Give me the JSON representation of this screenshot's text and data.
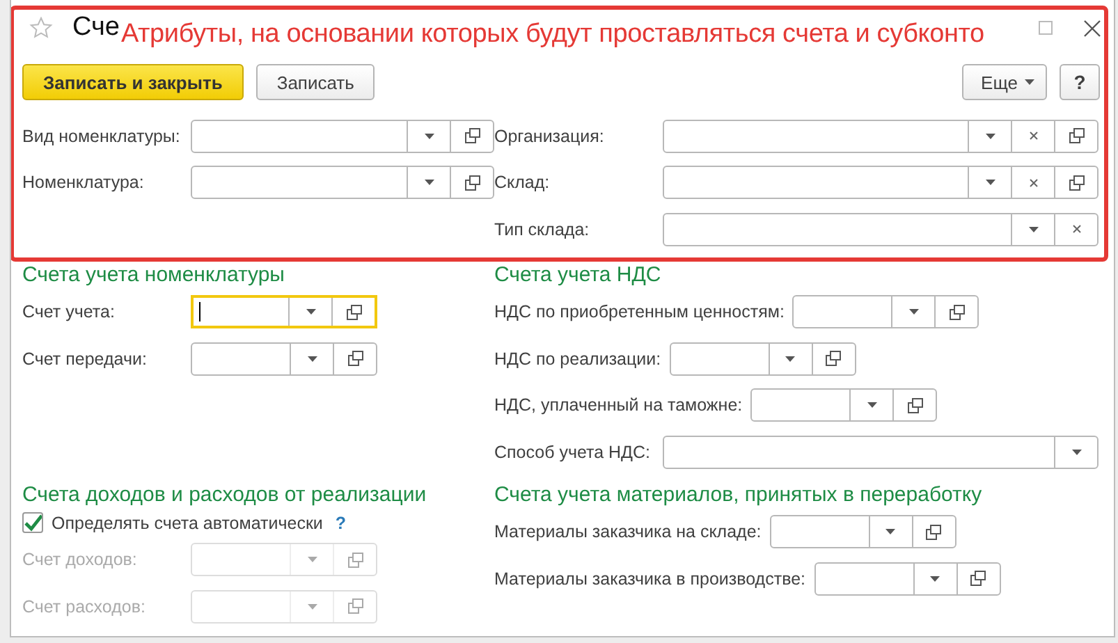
{
  "window": {
    "title": "Сче"
  },
  "annotation": {
    "text": "Атрибуты, на основании которых будут проставляться счета и субконто"
  },
  "toolbar": {
    "buttons": [
      {
        "label": "Записать и закрыть",
        "kind": "primary"
      },
      {
        "label": "Записать",
        "kind": "plain"
      }
    ],
    "more": "Еще",
    "help": "?"
  },
  "top": {
    "left": [
      {
        "label": "Вид номенклатуры:",
        "clear": false,
        "open": true,
        "disabled": false,
        "focused": false
      },
      {
        "label": "Номенклатура:",
        "clear": false,
        "open": true,
        "disabled": false,
        "focused": false
      }
    ],
    "right": [
      {
        "label": "Организация:",
        "clear": true,
        "open": true,
        "disabled": false,
        "focused": false
      },
      {
        "label": "Склад:",
        "clear": true,
        "open": true,
        "disabled": false,
        "focused": false
      },
      {
        "label": "Тип склада:",
        "clear": true,
        "open": false,
        "disabled": false,
        "focused": false
      }
    ]
  },
  "groups": [
    {
      "left": {
        "heading": "Счета учета номенклатуры",
        "fields": [
          {
            "label": "Счет учета:",
            "clear": false,
            "open": true,
            "disabled": false,
            "focused": true
          },
          {
            "label": "Счет передачи:",
            "clear": false,
            "open": true,
            "disabled": false,
            "focused": false
          }
        ]
      },
      "right": {
        "heading": "Счета учета НДС",
        "fields": [
          {
            "label": "НДС по приобретенным ценностям:",
            "clear": false,
            "open": true,
            "disabled": false,
            "focused": false
          },
          {
            "label": "НДС по реализации:",
            "clear": false,
            "open": true,
            "disabled": false,
            "focused": false
          },
          {
            "label": "НДС, уплаченный на таможне:",
            "clear": false,
            "open": true,
            "disabled": false,
            "focused": false
          },
          {
            "label": "Способ учета НДС:",
            "clear": false,
            "open": false,
            "disabled": false,
            "focused": false
          }
        ]
      }
    },
    {
      "left": {
        "heading": "Счета доходов и расходов от реализации",
        "checkbox": {
          "label": "Определять счета автоматически",
          "checked": true,
          "help": "?"
        },
        "fields": [
          {
            "label": "Счет доходов:",
            "clear": false,
            "open": true,
            "disabled": true,
            "focused": false
          },
          {
            "label": "Счет расходов:",
            "clear": false,
            "open": true,
            "disabled": true,
            "focused": false
          }
        ]
      },
      "right": {
        "heading": "Счета учета материалов, принятых в переработку",
        "fields": [
          {
            "label": "Материалы заказчика на складе:",
            "clear": false,
            "open": true,
            "disabled": false,
            "focused": false
          },
          {
            "label": "Материалы заказчика в производстве:",
            "clear": false,
            "open": true,
            "disabled": false,
            "focused": false
          }
        ]
      }
    }
  ]
}
